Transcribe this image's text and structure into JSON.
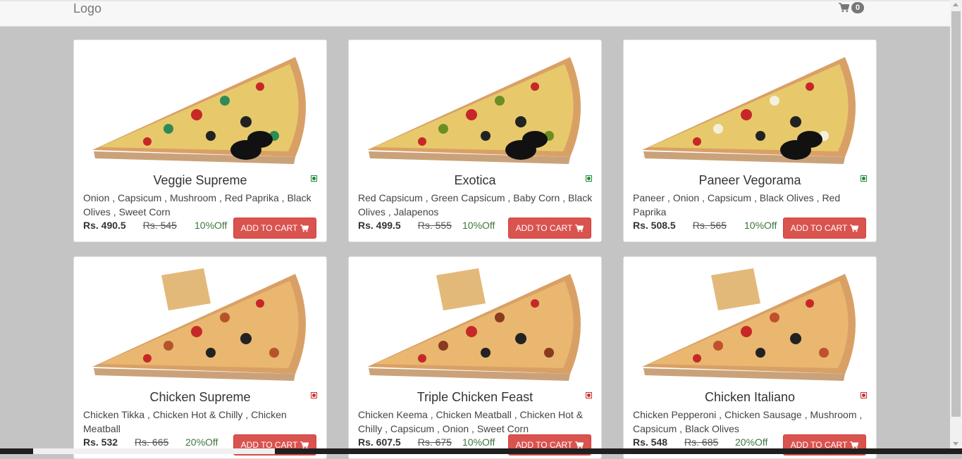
{
  "navbar": {
    "logo": "Logo",
    "cart_count": "0"
  },
  "products": [
    {
      "name": "Veggie Supreme",
      "description": "Onion , Capsicum , Mushroom , Red Paprika , Black Olives , Sweet Corn",
      "price": "Rs. 490.5",
      "mrp": "Rs. 545",
      "discount": "10%Off",
      "button": "ADD TO CART",
      "veg": true,
      "topping_color": "#2e8b57"
    },
    {
      "name": "Exotica",
      "description": "Red Capsicum , Green Capsicum , Baby Corn , Black Olives , Jalapenos",
      "price": "Rs. 499.5",
      "mrp": "Rs. 555",
      "discount": "10%Off",
      "button": "ADD TO CART",
      "veg": true,
      "topping_color": "#6b8e23"
    },
    {
      "name": "Paneer Vegorama",
      "description": "Paneer , Onion , Capsicum , Black Olives , Red Paprika",
      "price": "Rs. 508.5",
      "mrp": "Rs. 565",
      "discount": "10%Off",
      "button": "ADD TO CART",
      "veg": true,
      "topping_color": "#f5f0dc"
    },
    {
      "name": "Chicken Supreme",
      "description": "Chicken Tikka , Chicken Hot & Chilly , Chicken Meatball",
      "price": "Rs. 532",
      "mrp": "Rs. 665",
      "discount": "20%Off",
      "button": "ADD TO CART",
      "veg": false,
      "topping_color": "#b5542b"
    },
    {
      "name": "Triple Chicken Feast",
      "description": "Chicken Keema , Chicken Meatball , Chicken Hot & Chilly , Capsicum , Onion , Sweet Corn",
      "price": "Rs. 607.5",
      "mrp": "Rs. 675",
      "discount": "10%Off",
      "button": "ADD TO CART",
      "veg": false,
      "topping_color": "#8a3a1f"
    },
    {
      "name": "Chicken Italiano",
      "description": "Chicken Pepperoni , Chicken Sausage , Mushroom , Capsicum , Black Olives",
      "price": "Rs. 548",
      "mrp": "Rs. 685",
      "discount": "20%Off",
      "button": "ADD TO CART",
      "veg": false,
      "topping_color": "#c0502e"
    }
  ],
  "colors": {
    "veg": "#1f8a3b",
    "nonveg": "#c9302c",
    "button": "#d9534f",
    "discount": "#3c763d"
  }
}
